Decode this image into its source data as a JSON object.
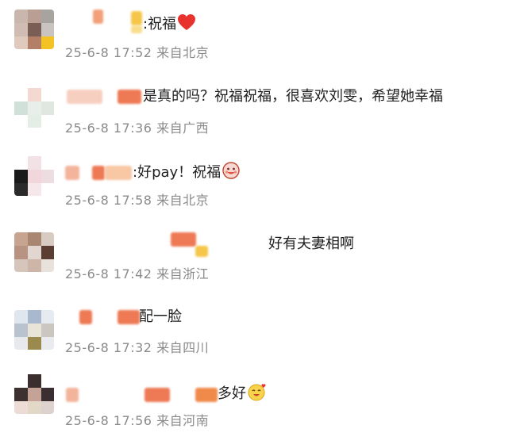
{
  "comments": [
    {
      "text": ":祝福",
      "emoji": "red-heart",
      "time": "25-6-8 17:52",
      "location": "来自北京"
    },
    {
      "text": "是真的吗？祝福祝福，很喜欢刘雯，希望她幸福",
      "emoji": "",
      "time": "25-6-8 17:36",
      "location": "来自广西"
    },
    {
      "text": ":好pay！祝福",
      "emoji": "smiling-face",
      "time": "25-6-8 17:58",
      "location": "来自北京"
    },
    {
      "text": "好有夫妻相啊",
      "emoji": "",
      "time": "25-6-8 17:42",
      "location": "来自浙江"
    },
    {
      "text": "配一脸",
      "emoji": "",
      "time": "25-6-8 17:32",
      "location": "来自四川"
    },
    {
      "text": "多好",
      "emoji": "smiling-face-with-hearts",
      "time": "25-6-8 17:56",
      "location": "来自河南"
    }
  ]
}
